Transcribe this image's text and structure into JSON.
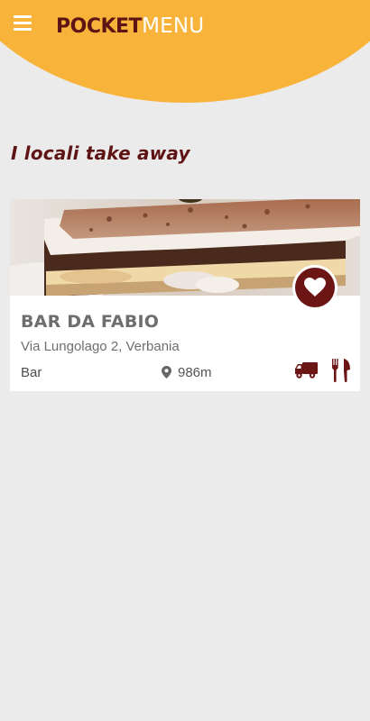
{
  "app": {
    "logo_bold": "POCKET",
    "logo_light": "MENU"
  },
  "colors": {
    "header": "#f8b33a",
    "brand_dark": "#5e1414",
    "background": "#ebebeb",
    "card": "#ffffff"
  },
  "icons": {
    "menu": "hamburger-menu-icon",
    "favorite": "heart-icon",
    "location": "location-pin-icon",
    "delivery": "delivery-truck-icon",
    "dine_in": "fork-knife-icon"
  },
  "page": {
    "title": "I locali take away"
  },
  "venues": [
    {
      "name": "BAR DA FABIO",
      "address": "Via Lungolago 2, Verbania",
      "category": "Bar",
      "distance": "986m",
      "image": "cake-slice-photo",
      "favorite": true,
      "services": [
        "delivery",
        "dine-in"
      ]
    }
  ]
}
